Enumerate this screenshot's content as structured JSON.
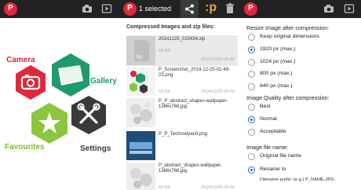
{
  "colors": {
    "toolbar": "#222222",
    "logo_red": "#e0283a",
    "accent_orange": "#f2a23a",
    "camera_hex": "#e0283a",
    "gallery_hex": "#1f9a6b",
    "favourites_hex": "#8cc63e",
    "settings_hex": "#3a3a3a",
    "radio_selected": "#2a6fc4"
  },
  "screen_left": {
    "toolbar": {
      "logo_icon": "p-logo",
      "actions": [
        "camera-icon",
        "play-icon"
      ]
    },
    "tiles": [
      {
        "label": "Camera",
        "icon": "camera-icon"
      },
      {
        "label": "Gallery",
        "icon": "gallery-icon"
      },
      {
        "label": "Favourites",
        "icon": "star-icon"
      },
      {
        "label": "Settings",
        "icon": "tools-icon"
      }
    ]
  },
  "screen_middle": {
    "toolbar": {
      "logo_icon": "p-logo",
      "selection_text": "1 selected",
      "actions": [
        "share-icon",
        "zip-p-icon",
        "delete-icon"
      ]
    },
    "header": "Compressed Images and zip files:",
    "files": [
      {
        "name": "20141225_015434.zip",
        "size": "69 KB",
        "date": "2014/12/25 05:44",
        "thumb": "zip-icon",
        "selected": true
      },
      {
        "name": "P_Screenshot_2014-12-25-01-49-23.png",
        "size": "63 KB",
        "date": "2014/12/25 05:44",
        "thumb": "screenshot-thumb",
        "selected": false
      },
      {
        "name": "P_P_abstract_shapes-wallpaper-1366x768.jpg",
        "size": "",
        "date": "",
        "thumb": "abstract-thumb",
        "selected": false
      },
      {
        "name": "P_P_Technodyan3.png",
        "size": "",
        "date": "",
        "thumb": "technodyan-thumb",
        "selected": false
      },
      {
        "name": "P_abstract_shapes-wallpaper-1366x768.jpg",
        "size": "60 KB",
        "date": "2014/12/25 05:44",
        "thumb": "abstract-thumb",
        "selected": false
      }
    ]
  },
  "screen_right": {
    "toolbar": {
      "logo_icon": "p-logo",
      "actions": [
        "camera-icon",
        "play-icon"
      ]
    },
    "resize_title": "Resize Image after compression:",
    "resize_options": [
      {
        "label": "Keep original dimensions",
        "checked": false
      },
      {
        "label": "1920 px (max.)",
        "checked": true
      },
      {
        "label": "1024 px (max.)",
        "checked": false
      },
      {
        "label": "800 px (max.)",
        "checked": false
      },
      {
        "label": "640 px (max.)",
        "checked": false
      }
    ],
    "quality_title": "Image Quality after compression:",
    "quality_options": [
      {
        "label": "Best",
        "checked": false
      },
      {
        "label": "Normal",
        "checked": true
      },
      {
        "label": "Acceptable",
        "checked": false
      }
    ],
    "filename_title": "Image file name:",
    "filename_options": [
      {
        "label": "Original file name",
        "checked": false
      },
      {
        "label": "Rename to",
        "checked": true
      }
    ],
    "prefix_label": "Filename prefix: (e.g.) P_NAME.JPG"
  }
}
